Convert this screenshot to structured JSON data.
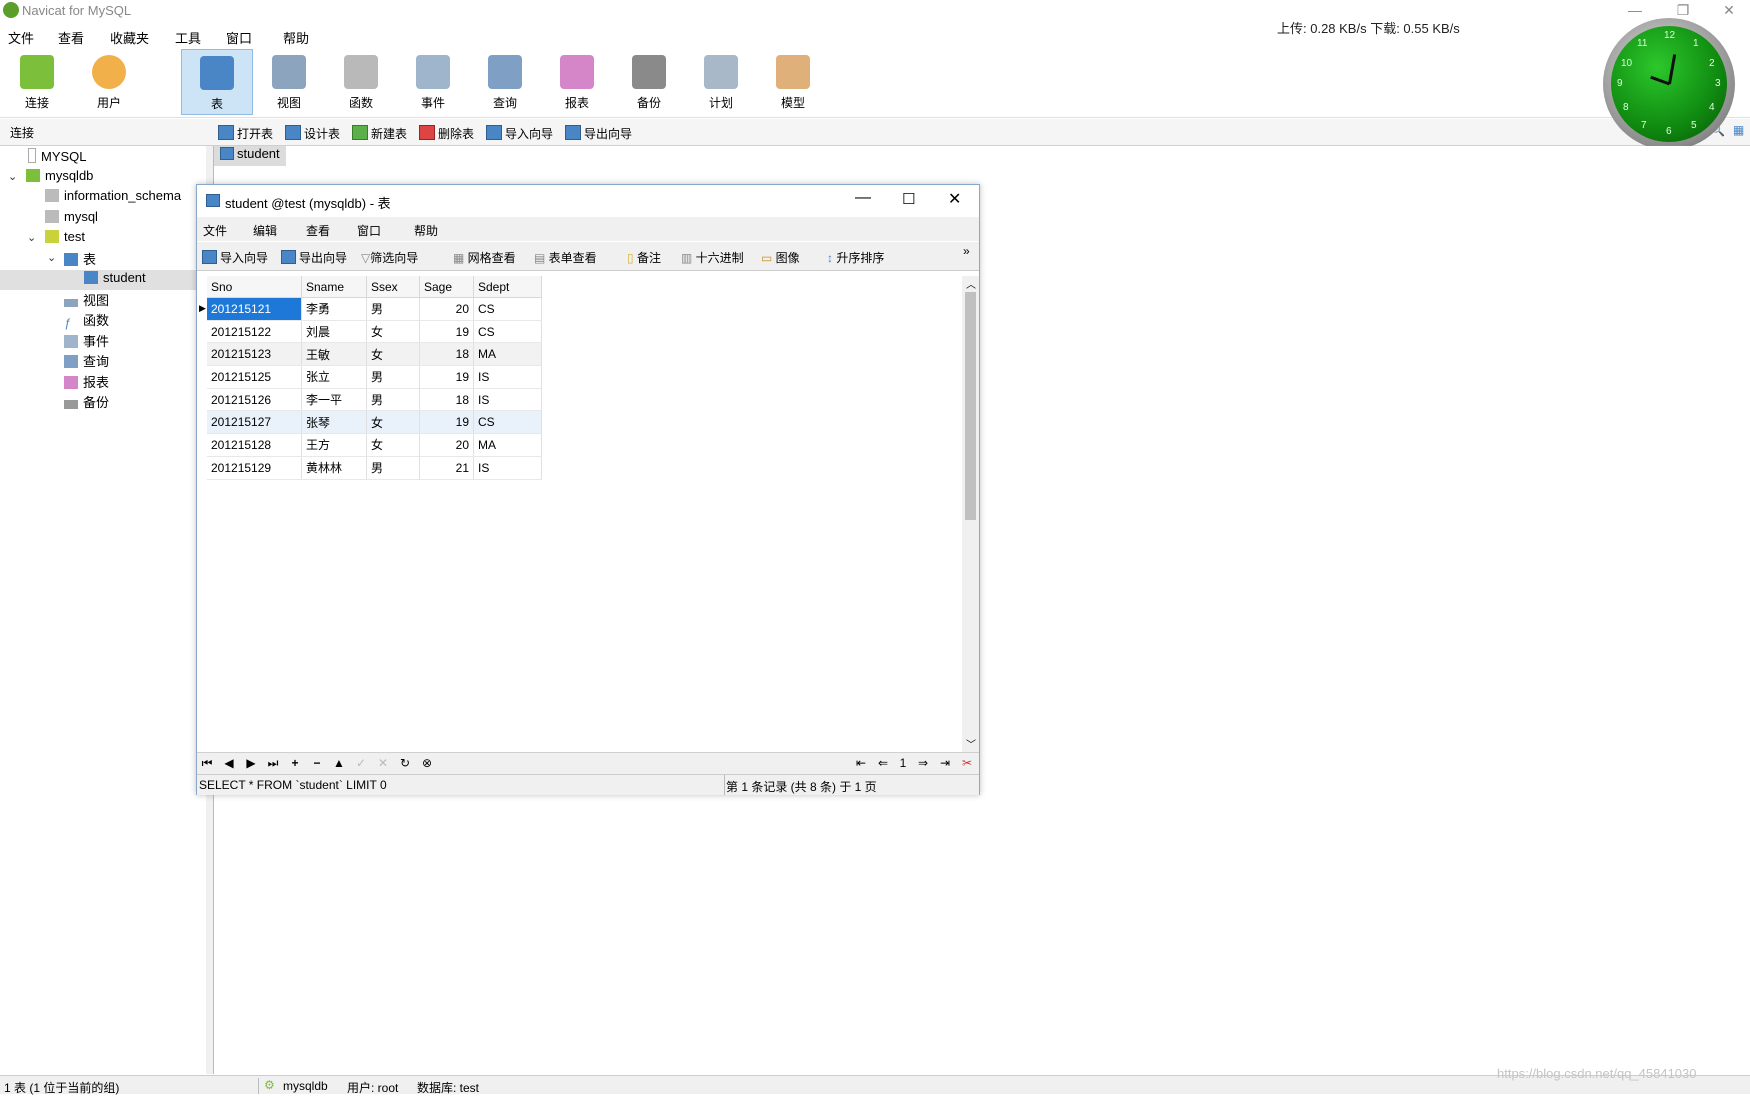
{
  "app": {
    "title": "Navicat for MySQL",
    "speed": "上传: 0.28 KB/s   下载: 0.55 KB/s"
  },
  "menubar": [
    "文件",
    "查看",
    "收藏夹",
    "工具",
    "窗口",
    "帮助"
  ],
  "toolbar": [
    {
      "label": "连接",
      "icon": "connect-icon"
    },
    {
      "label": "用户",
      "icon": "user-icon"
    },
    {
      "label": "表",
      "icon": "table-icon"
    },
    {
      "label": "视图",
      "icon": "view-icon"
    },
    {
      "label": "函数",
      "icon": "function-icon"
    },
    {
      "label": "事件",
      "icon": "event-icon"
    },
    {
      "label": "查询",
      "icon": "query-icon"
    },
    {
      "label": "报表",
      "icon": "report-icon"
    },
    {
      "label": "备份",
      "icon": "backup-icon"
    },
    {
      "label": "计划",
      "icon": "schedule-icon"
    },
    {
      "label": "模型",
      "icon": "model-icon"
    }
  ],
  "clock_numbers": [
    "12",
    "1",
    "2",
    "3",
    "4",
    "5",
    "6",
    "7",
    "8",
    "9",
    "10",
    "11"
  ],
  "subbar": {
    "section": "连接",
    "actions": [
      "打开表",
      "设计表",
      "新建表",
      "删除表",
      "导入向导",
      "导出向导"
    ]
  },
  "tree": {
    "items": [
      "MYSQL",
      "mysqldb",
      "information_schema",
      "mysql",
      "test",
      "表",
      "student",
      "视图",
      "函数",
      "事件",
      "查询",
      "报表",
      "备份"
    ]
  },
  "object_tab": "student",
  "window": {
    "title": "student @test (mysqldb) - 表",
    "menu": [
      "文件",
      "编辑",
      "查看",
      "窗口",
      "帮助"
    ],
    "tools": [
      "导入向导",
      "导出向导",
      "筛选向导",
      "网格查看",
      "表单查看",
      "备注",
      "十六进制",
      "图像",
      "升序排序"
    ],
    "columns": [
      "Sno",
      "Sname",
      "Ssex",
      "Sage",
      "Sdept"
    ],
    "rows": [
      [
        "201215121",
        "李勇",
        "男",
        "20",
        "CS"
      ],
      [
        "201215122",
        "刘晨",
        "女",
        "19",
        "CS"
      ],
      [
        "201215123",
        "王敏",
        "女",
        "18",
        "MA"
      ],
      [
        "201215125",
        "张立",
        "男",
        "19",
        "IS"
      ],
      [
        "201215126",
        "李一平",
        "男",
        "18",
        "IS"
      ],
      [
        "201215127",
        "张琴",
        "女",
        "19",
        "CS"
      ],
      [
        "201215128",
        "王方",
        "女",
        "20",
        "MA"
      ],
      [
        "201215129",
        "黄林林",
        "男",
        "21",
        "IS"
      ]
    ],
    "page": "1",
    "sql": "SELECT * FROM `student` LIMIT 0",
    "record_info": "第 1 条记录 (共 8 条) 于 1 页"
  },
  "status": {
    "left": "1 表 (1 位于当前的组)",
    "connection": "mysqldb",
    "user": "用户: root",
    "db": "数据库: test"
  },
  "watermark": "https://blog.csdn.net/qq_45841030",
  "colors": {
    "selection": "#1e78d7",
    "toolbar_active": "#cde4f7",
    "clock_green": "#108a10"
  }
}
